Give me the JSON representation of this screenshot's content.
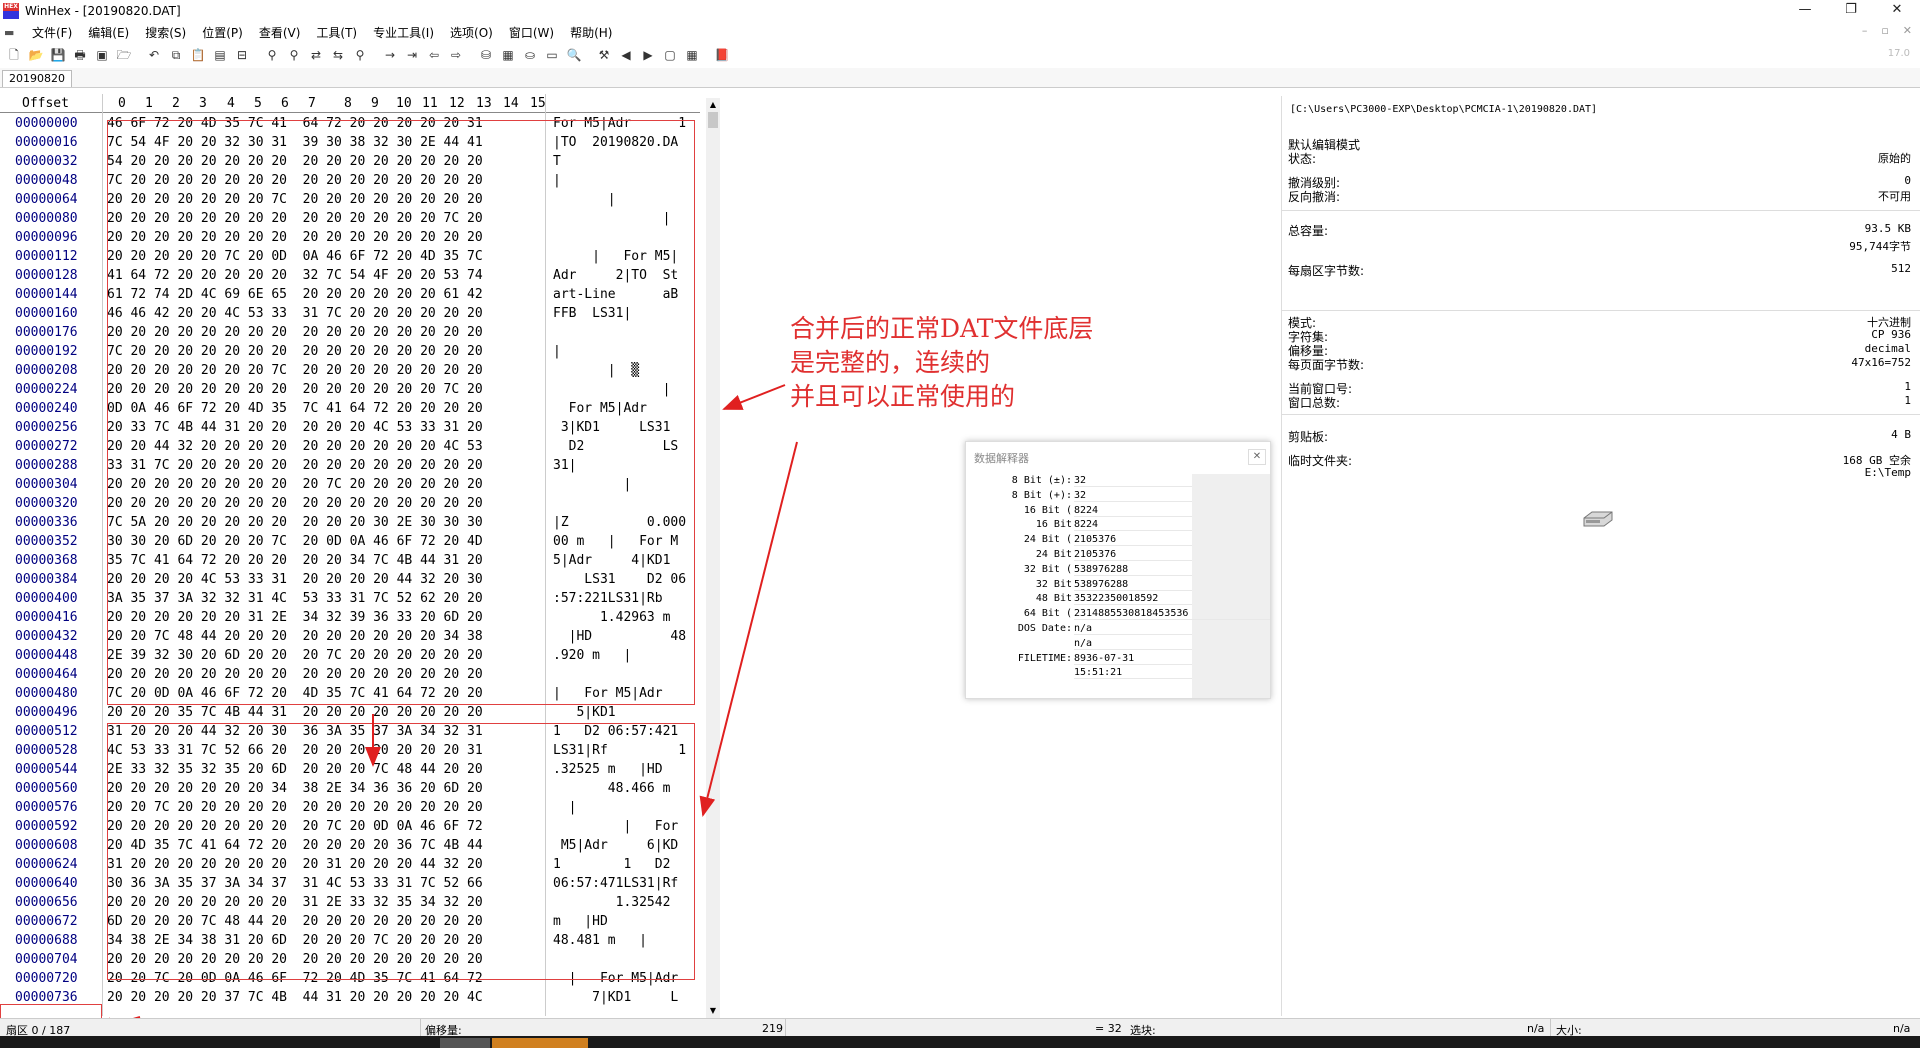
{
  "window": {
    "title": "WinHex - [20190820.DAT]",
    "app_icon_text": "HEX"
  },
  "menu": {
    "items": [
      "文件(F)",
      "编辑(E)",
      "搜索(S)",
      "位置(P)",
      "查看(V)",
      "工具(T)",
      "专业工具(I)",
      "选项(O)",
      "窗口(W)",
      "帮助(H)"
    ]
  },
  "toolbar": {
    "version": "17.0"
  },
  "tab": {
    "label": "20190820"
  },
  "hex_view": {
    "offset_header": "Offset",
    "column_headers": [
      "0",
      "1",
      "2",
      "3",
      "4",
      "5",
      "6",
      "7",
      "8",
      "9",
      "10",
      "11",
      "12",
      "13",
      "14",
      "15"
    ],
    "rows": [
      {
        "off": "00000000",
        "hex": "46 6F 72 20 4D 35 7C 41  64 72 20 20 20 20 20 31",
        "txt": "For M5|Adr      1"
      },
      {
        "off": "00000016",
        "hex": "7C 54 4F 20 20 32 30 31  39 30 38 32 30 2E 44 41",
        "txt": "|TO  20190820.DA"
      },
      {
        "off": "00000032",
        "hex": "54 20 20 20 20 20 20 20  20 20 20 20 20 20 20 20",
        "txt": "T"
      },
      {
        "off": "00000048",
        "hex": "7C 20 20 20 20 20 20 20  20 20 20 20 20 20 20 20",
        "txt": "|"
      },
      {
        "off": "00000064",
        "hex": "20 20 20 20 20 20 20 7C  20 20 20 20 20 20 20 20",
        "txt": "       |"
      },
      {
        "off": "00000080",
        "hex": "20 20 20 20 20 20 20 20  20 20 20 20 20 20 7C 20",
        "txt": "              |"
      },
      {
        "off": "00000096",
        "hex": "20 20 20 20 20 20 20 20  20 20 20 20 20 20 20 20",
        "txt": ""
      },
      {
        "off": "00000112",
        "hex": "20 20 20 20 20 7C 20 0D  0A 46 6F 72 20 4D 35 7C",
        "txt": "     |   For M5|"
      },
      {
        "off": "00000128",
        "hex": "41 64 72 20 20 20 20 20  32 7C 54 4F 20 20 53 74",
        "txt": "Adr     2|TO  St"
      },
      {
        "off": "00000144",
        "hex": "61 72 74 2D 4C 69 6E 65  20 20 20 20 20 20 61 42",
        "txt": "art-Line      aB"
      },
      {
        "off": "00000160",
        "hex": "46 46 42 20 20 4C 53 33  31 7C 20 20 20 20 20 20",
        "txt": "FFB  LS31|"
      },
      {
        "off": "00000176",
        "hex": "20 20 20 20 20 20 20 20  20 20 20 20 20 20 20 20",
        "txt": ""
      },
      {
        "off": "00000192",
        "hex": "7C 20 20 20 20 20 20 20  20 20 20 20 20 20 20 20",
        "txt": "|"
      },
      {
        "off": "00000208",
        "hex": "20 20 20 20 20 20 20 7C  20 20 20 20 20 20 20 20",
        "txt": "       |  ▒"
      },
      {
        "off": "00000224",
        "hex": "20 20 20 20 20 20 20 20  20 20 20 20 20 20 7C 20",
        "txt": "              |"
      },
      {
        "off": "00000240",
        "hex": "0D 0A 46 6F 72 20 4D 35  7C 41 64 72 20 20 20 20",
        "txt": "  For M5|Adr"
      },
      {
        "off": "00000256",
        "hex": "20 33 7C 4B 44 31 20 20  20 20 20 4C 53 33 31 20",
        "txt": " 3|KD1     LS31"
      },
      {
        "off": "00000272",
        "hex": "20 20 44 32 20 20 20 20  20 20 20 20 20 20 4C 53",
        "txt": "  D2          LS"
      },
      {
        "off": "00000288",
        "hex": "33 31 7C 20 20 20 20 20  20 20 20 20 20 20 20 20",
        "txt": "31|"
      },
      {
        "off": "00000304",
        "hex": "20 20 20 20 20 20 20 20  20 7C 20 20 20 20 20 20",
        "txt": "         |"
      },
      {
        "off": "00000320",
        "hex": "20 20 20 20 20 20 20 20  20 20 20 20 20 20 20 20",
        "txt": ""
      },
      {
        "off": "00000336",
        "hex": "7C 5A 20 20 20 20 20 20  20 20 20 30 2E 30 30 30",
        "txt": "|Z          0.000"
      },
      {
        "off": "00000352",
        "hex": "30 30 20 6D 20 20 20 7C  20 0D 0A 46 6F 72 20 4D",
        "txt": "00 m   |   For M"
      },
      {
        "off": "00000368",
        "hex": "35 7C 41 64 72 20 20 20  20 20 34 7C 4B 44 31 20",
        "txt": "5|Adr     4|KD1"
      },
      {
        "off": "00000384",
        "hex": "20 20 20 20 4C 53 33 31  20 20 20 20 44 32 20 30",
        "txt": "    LS31    D2 06"
      },
      {
        "off": "00000400",
        "hex": "3A 35 37 3A 32 32 31 4C  53 33 31 7C 52 62 20 20",
        "txt": ":57:221LS31|Rb"
      },
      {
        "off": "00000416",
        "hex": "20 20 20 20 20 20 31 2E  34 32 39 36 33 20 6D 20",
        "txt": "      1.42963 m"
      },
      {
        "off": "00000432",
        "hex": "20 20 7C 48 44 20 20 20  20 20 20 20 20 20 34 38",
        "txt": "  |HD          48"
      },
      {
        "off": "00000448",
        "hex": "2E 39 32 30 20 6D 20 20  20 7C 20 20 20 20 20 20",
        "txt": ".920 m   |"
      },
      {
        "off": "00000464",
        "hex": "20 20 20 20 20 20 20 20  20 20 20 20 20 20 20 20",
        "txt": ""
      },
      {
        "off": "00000480",
        "hex": "7C 20 0D 0A 46 6F 72 20  4D 35 7C 41 64 72 20 20",
        "txt": "|   For M5|Adr"
      },
      {
        "off": "00000496",
        "hex": "20 20 20 35 7C 4B 44 31  20 20 20 20 20 20 20 20",
        "txt": "   5|KD1"
      },
      {
        "off": "00000512",
        "hex": "31 20 20 20 44 32 20 30  36 3A 35 37 3A 34 32 31",
        "txt": "1   D2 06:57:421"
      },
      {
        "off": "00000528",
        "hex": "4C 53 33 31 7C 52 66 20  20 20 20 20 20 20 20 31",
        "txt": "LS31|Rf         1"
      },
      {
        "off": "00000544",
        "hex": "2E 33 32 35 32 35 20 6D  20 20 20 7C 48 44 20 20",
        "txt": ".32525 m   |HD"
      },
      {
        "off": "00000560",
        "hex": "20 20 20 20 20 20 20 34  38 2E 34 36 36 20 6D 20",
        "txt": "       48.466 m"
      },
      {
        "off": "00000576",
        "hex": "20 20 7C 20 20 20 20 20  20 20 20 20 20 20 20 20",
        "txt": "  |"
      },
      {
        "off": "00000592",
        "hex": "20 20 20 20 20 20 20 20  20 7C 20 0D 0A 46 6F 72",
        "txt": "         |   For"
      },
      {
        "off": "00000608",
        "hex": "20 4D 35 7C 41 64 72 20  20 20 20 20 36 7C 4B 44",
        "txt": " M5|Adr     6|KD"
      },
      {
        "off": "00000624",
        "hex": "31 20 20 20 20 20 20 20  20 31 20 20 20 44 32 20",
        "txt": "1        1   D2"
      },
      {
        "off": "00000640",
        "hex": "30 36 3A 35 37 3A 34 37  31 4C 53 33 31 7C 52 66",
        "txt": "06:57:471LS31|Rf"
      },
      {
        "off": "00000656",
        "hex": "20 20 20 20 20 20 20 20  31 2E 33 32 35 34 32 20",
        "txt": "        1.32542"
      },
      {
        "off": "00000672",
        "hex": "6D 20 20 20 7C 48 44 20  20 20 20 20 20 20 20 20",
        "txt": "m   |HD"
      },
      {
        "off": "00000688",
        "hex": "34 38 2E 34 38 31 20 6D  20 20 20 7C 20 20 20 20",
        "txt": "48.481 m   |"
      },
      {
        "off": "00000704",
        "hex": "20 20 20 20 20 20 20 20  20 20 20 20 20 20 20 20",
        "txt": ""
      },
      {
        "off": "00000720",
        "hex": "20 20 7C 20 0D 0A 46 6F  72 20 4D 35 7C 41 64 72",
        "txt": "  |   For M5|Adr"
      },
      {
        "off": "00000736",
        "hex": "20 20 20 20 20 37 7C 4B  44 31 20 20 20 20 20 4C",
        "txt": "     7|KD1     L"
      }
    ]
  },
  "annotation": {
    "lines": [
      "合并后的正常DAT文件底层",
      "是完整的，连续的",
      "并且可以正常使用的"
    ],
    "color": "#e03030"
  },
  "data_interpreter": {
    "title": "数据解释器",
    "rows": [
      {
        "label": "8 Bit (±):",
        "value": "32"
      },
      {
        "label": "8 Bit (+):",
        "value": "32"
      },
      {
        "label": "16 Bit (",
        "value": "8224"
      },
      {
        "label": "16 Bit",
        "value": "8224"
      },
      {
        "label": "24 Bit (",
        "value": "2105376"
      },
      {
        "label": "24 Bit",
        "value": "2105376"
      },
      {
        "label": "32 Bit (",
        "value": "538976288"
      },
      {
        "label": "32 Bit",
        "value": "538976288"
      },
      {
        "label": "48 Bit",
        "value": "35322350018592"
      },
      {
        "label": "64 Bit (",
        "value": "2314885530818453536"
      },
      {
        "label": "DOS Date:",
        "value": "n/a"
      },
      {
        "label": "",
        "value": "n/a"
      },
      {
        "label": "FILETIME:",
        "value": "8936-07-31"
      },
      {
        "label": "",
        "value": "15:51:21"
      }
    ]
  },
  "info_panel": {
    "path": "[C:\\Users\\PC3000-EXP\\Desktop\\PCMCIA-1\\20190820.DAT]",
    "default_mode": "默认编辑模式",
    "state_label": "状态:",
    "state_value": "原始的",
    "undo_level_label": "撤消级别:",
    "undo_level_value": "0",
    "reverse_undo_label": "反向撤消:",
    "reverse_undo_value": "不可用",
    "capacity_label": "总容量:",
    "capacity_value1": "93.5 KB",
    "capacity_value2": "95,744字节",
    "bytes_per_sector_label": "每扇区字节数:",
    "bytes_per_sector_value": "512",
    "mode_label": "模式:",
    "mode_value": "十六进制",
    "charset_label": "字符集:",
    "charset_value": "CP 936",
    "offset_label": "偏移量:",
    "offset_value": "decimal",
    "bytes_per_page_label": "每页面字节数:",
    "bytes_per_page_value": "47x16=752",
    "cur_window_label": "当前窗口号:",
    "cur_window_value": "1",
    "window_total_label": "窗口总数:",
    "window_total_value": "1",
    "clipboard_label": "剪贴板:",
    "clipboard_value": "4 B",
    "temp_label": "临时文件夹:",
    "temp_value1": "168 GB 空余",
    "temp_value2": "E:\\Temp"
  },
  "statusbar": {
    "sector": "扇区 0 / 187",
    "offset_label": "偏移量:",
    "offset_value": "219",
    "eq_value": "= 32",
    "select_label": "选块:",
    "select_value": "n/a",
    "size_label": "大小:",
    "size_value": "n/a"
  }
}
